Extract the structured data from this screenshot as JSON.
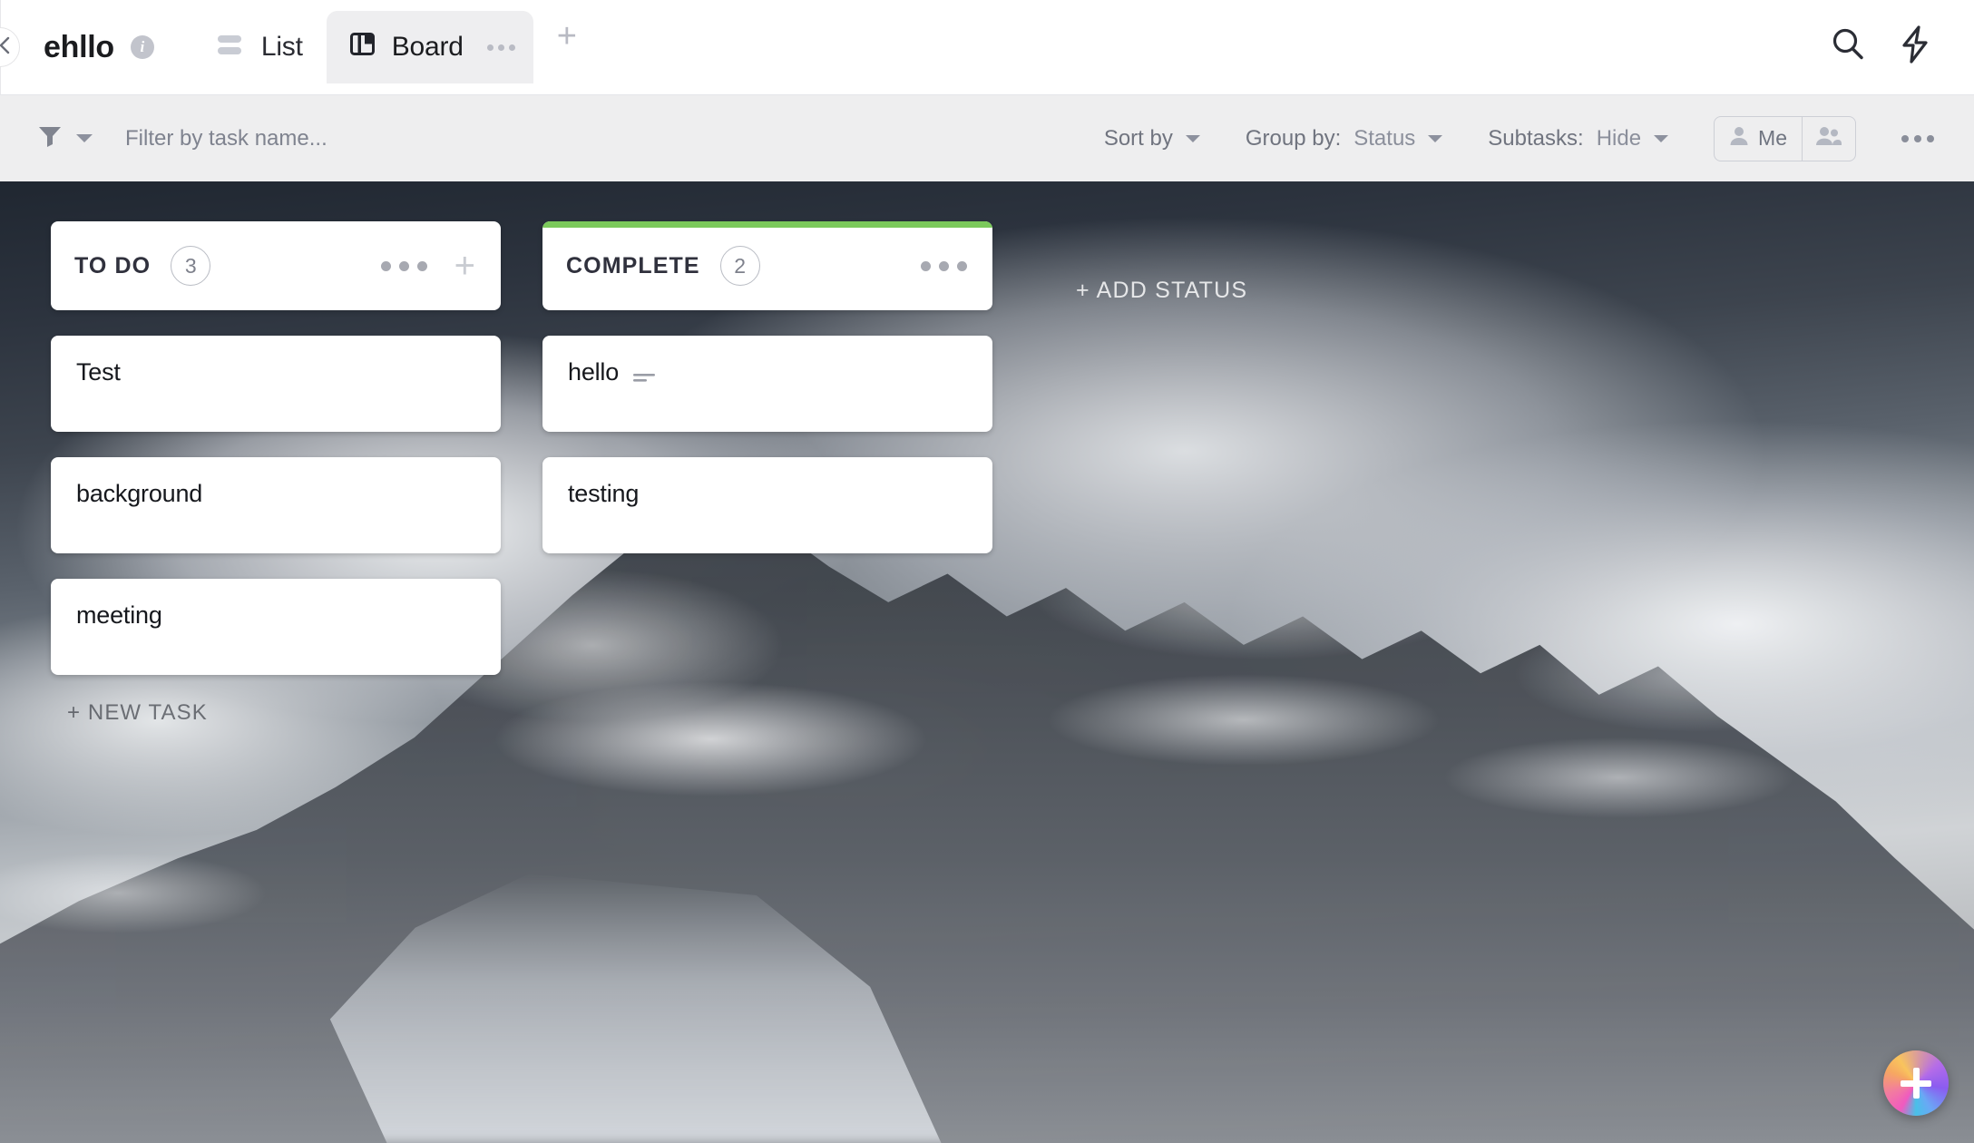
{
  "header": {
    "collapse_icon": "chevron-left-icon",
    "list_title": "ehllo",
    "info_icon": "info-icon",
    "tabs": [
      {
        "label": "List",
        "icon": "list-view-icon",
        "active": false
      },
      {
        "label": "Board",
        "icon": "board-view-icon",
        "active": true
      }
    ],
    "board_tab_menu_icon": "ellipsis-icon",
    "add_tab_label": "+",
    "search_icon": "search-icon",
    "automations_icon": "lightning-bolt-icon"
  },
  "toolbar": {
    "filter_icon": "filter-funnel-icon",
    "filter_caret_icon": "chevron-down-icon",
    "filter_placeholder": "Filter by task name...",
    "sort_by_label": "Sort by",
    "group_by_label": "Group by:",
    "group_by_value": "Status",
    "subtasks_label": "Subtasks:",
    "subtasks_value": "Hide",
    "me_label": "Me",
    "me_icon": "person-icon",
    "everyone_icon": "people-group-icon",
    "more_icon": "ellipsis-icon"
  },
  "board": {
    "add_status_label": "+ ADD STATUS",
    "new_task_label": "+ NEW TASK",
    "columns": [
      {
        "name": "TO DO",
        "count": "3",
        "accent": "transparent",
        "menu_icon": "ellipsis-icon",
        "add_icon": "plus-icon",
        "has_add_button": true,
        "cards": [
          {
            "title": "Test",
            "has_description": false
          },
          {
            "title": "background",
            "has_description": false
          },
          {
            "title": "meeting",
            "has_description": false
          }
        ]
      },
      {
        "name": "COMPLETE",
        "count": "2",
        "accent": "#7BC95B",
        "menu_icon": "ellipsis-icon",
        "add_icon": "plus-icon",
        "has_add_button": false,
        "cards": [
          {
            "title": "hello",
            "has_description": true
          },
          {
            "title": "testing",
            "has_description": false
          }
        ]
      }
    ]
  },
  "fab": {
    "icon": "plus-icon",
    "gradient": "#f05ac0"
  }
}
